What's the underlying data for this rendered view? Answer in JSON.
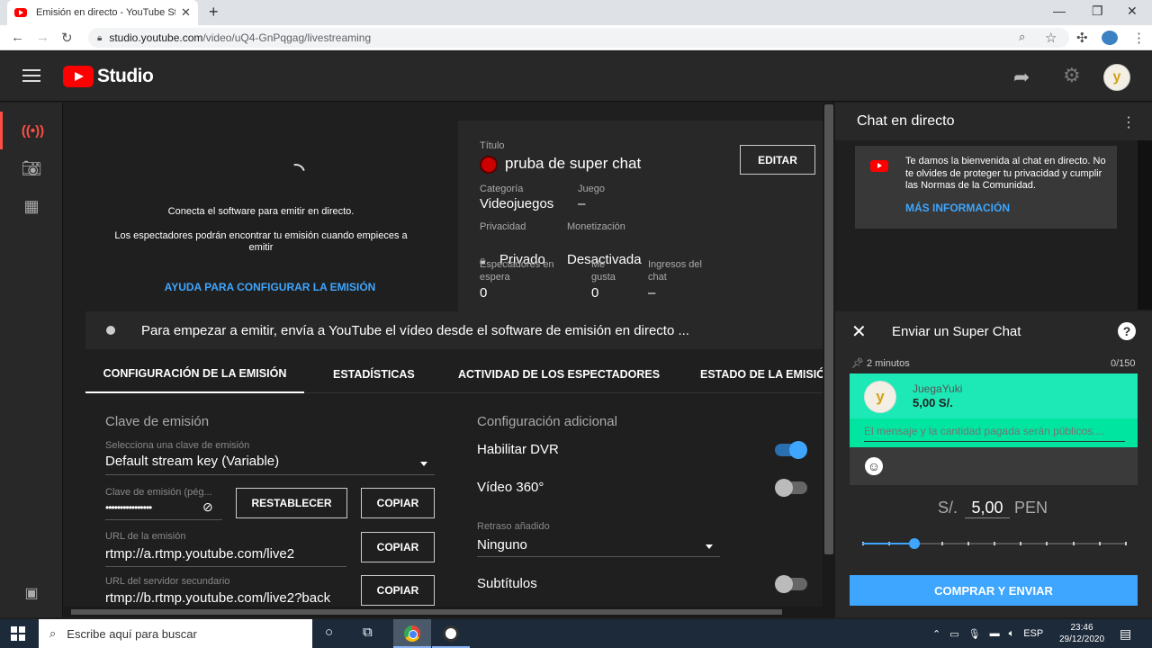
{
  "browser": {
    "tab_title": "Emisión en directo - YouTube Studio",
    "tab_close": "✕",
    "new_tab": "+",
    "url_host": "studio.youtube.com",
    "url_path": "/video/uQ4-GnPqgag/livestreaming",
    "minimize": "—",
    "maximize": "❐",
    "close": "✕"
  },
  "header": {
    "logo_text": "Studio",
    "avatar_letter": "y"
  },
  "preview": {
    "connect_text": "Conecta el software para emitir en directo.",
    "viewers_text": "Los espectadores podrán encontrar tu emisión cuando empieces a emitir",
    "help_link": "AYUDA PARA CONFIGURAR LA EMISIÓN"
  },
  "info": {
    "title_label": "Título",
    "title_value": "pruba de super chat",
    "edit_button": "EDITAR",
    "category_label": "Categoría",
    "category_value": "Videojuegos",
    "game_label": "Juego",
    "game_value": "–",
    "privacy_label": "Privacidad",
    "privacy_value": "Privado",
    "monetization_label": "Monetización",
    "monetization_value": "Desactivada",
    "waiting_label": "Espectadores en espera",
    "waiting_value": "0",
    "likes_label": "Me gusta",
    "likes_value": "0",
    "chat_income_label": "Ingresos del chat",
    "chat_income_value": "–"
  },
  "status": {
    "text": "Para empezar a emitir, envía a YouTube el vídeo desde el software de emisión en directo ..."
  },
  "tabs": [
    {
      "label": "CONFIGURACIÓN DE LA EMISIÓN",
      "active": true
    },
    {
      "label": "ESTADÍSTICAS",
      "active": false
    },
    {
      "label": "ACTIVIDAD DE LOS ESPECTADORES",
      "active": false
    },
    {
      "label": "ESTADO DE LA EMISIÓ",
      "active": false
    }
  ],
  "stream_key": {
    "section_title": "Clave de emisión",
    "select_label": "Selecciona una clave de emisión",
    "select_value": "Default stream key (Variable)",
    "key_label": "Clave de emisión (pég...",
    "key_value": "••••••••••••••••",
    "reset_button": "RESTABLECER",
    "copy_button": "COPIAR",
    "url_label": "URL de la emisión",
    "url_value": "rtmp://a.rtmp.youtube.com/live2",
    "backup_label": "URL del servidor secundario",
    "backup_value": "rtmp://b.rtmp.youtube.com/live2?back"
  },
  "additional": {
    "section_title": "Configuración adicional",
    "dvr_label": "Habilitar DVR",
    "dvr_on": true,
    "vr360_label": "Vídeo 360°",
    "vr360_on": false,
    "latency_label": "Retraso añadido",
    "latency_value": "Ninguno",
    "subtitles_label": "Subtítulos",
    "subtitles_on": false
  },
  "chat": {
    "title": "Chat en directo",
    "welcome_text": "Te damos la bienvenida al chat en directo. No te olvides de proteger tu privacidad y cumplir las Normas de la Comunidad.",
    "more_info": "MÁS INFORMACIÓN"
  },
  "superchat": {
    "title": "Enviar un Super Chat",
    "help": "?",
    "duration": "2 minutos",
    "char_count": "0/150",
    "user_name": "JuegaYuki",
    "amount_display": "5,00 S/.",
    "message_placeholder": "El mensaje y la cantidad pagada serán públicos....",
    "currency_symbol": "S/.",
    "amount_value": "5,00",
    "currency_code": "PEN",
    "slider_position": 0.2,
    "buy_button": "COMPRAR Y ENVIAR"
  },
  "taskbar": {
    "search_placeholder": "Escribe aquí para buscar",
    "language": "ESP",
    "time": "23:46",
    "date": "29/12/2020"
  },
  "colors": {
    "accent_blue": "#3ea6ff",
    "live_red": "#ff4e45",
    "superchat_green": "#1de9b6"
  }
}
